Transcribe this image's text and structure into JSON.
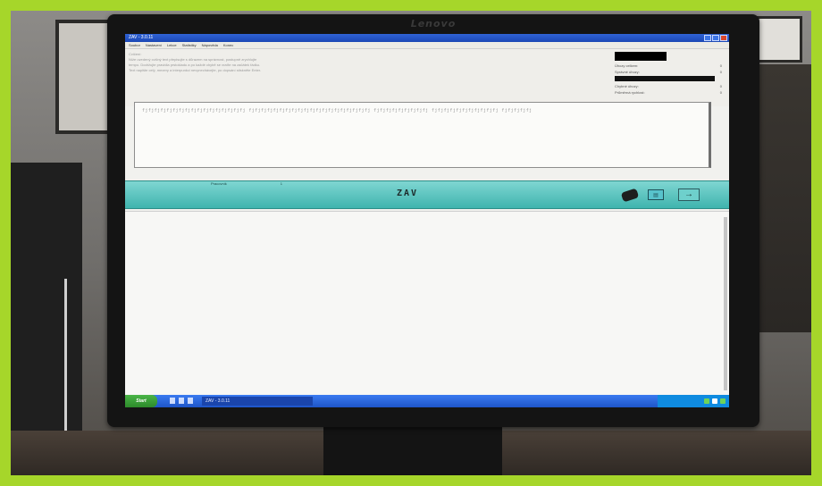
{
  "scene": {
    "monitor_brand": "Lenovo"
  },
  "window": {
    "title": "ZAV - 3.0.11",
    "menu": [
      "Soubor",
      "Nastavení",
      "Lekce",
      "Statistiky",
      "Nápověda",
      "Konec"
    ]
  },
  "instructions": {
    "heading": "Cvičení:",
    "lines": [
      "Níže uvedený cvičný text přepisujte s důrazem na správnost, postupně zrychlujte",
      "tempo. Dodržujte pravidla prstokladu a po každé chybě se vraťte na začátek řádku.",
      "Text napište celý, mezery a interpunkci nevynechávejte, po dopsání stiskněte Enter."
    ]
  },
  "stats": {
    "rows": [
      {
        "label": "Úhozy celkem:",
        "value": "0"
      },
      {
        "label": "Správné úhozy:",
        "value": "0"
      },
      {
        "label": "Chybné úhozy:",
        "value": "0"
      },
      {
        "label": "Průměrná rychlost:",
        "value": "0"
      }
    ]
  },
  "exercise": {
    "pattern": "fjfjfjfjfjfjfjfjfjfjfjfjfjfjfjfjfj  fjfjfjfjfjfjfjfjfjfjfjfjfjfjfjfjfjfjfjfj  fjfjfjfjfjfjfjfjfj  fjfjfjfjfjfjfjfjfjfjfj  fjfjfjfjfj"
  },
  "toolbar": {
    "level_label": "Pracovník",
    "level_value": "1",
    "center_label": "ZAV",
    "display_icon": "display-icon",
    "next_arrow": "→"
  },
  "taskbar": {
    "start_label": "Start",
    "task_label": "ZAV - 3.0.11"
  },
  "colors": {
    "toolbar_bg": "#4fc1bb",
    "frame": "#a6d62a",
    "titlebar": "#1b47b4"
  }
}
